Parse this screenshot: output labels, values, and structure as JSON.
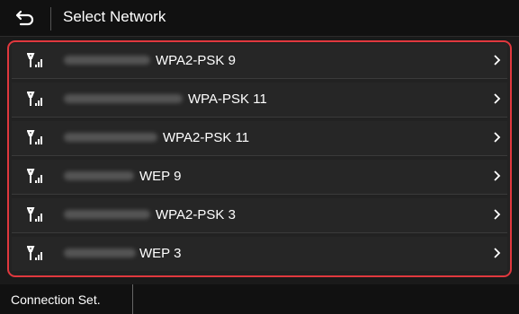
{
  "header": {
    "title": "Select Network",
    "back_icon": "back-arrow-icon"
  },
  "networks": [
    {
      "label": "WPA2-PSK 9",
      "icon": "antenna-signal-icon"
    },
    {
      "label": "WPA-PSK 11",
      "icon": "antenna-signal-icon"
    },
    {
      "label": "WPA2-PSK 11",
      "icon": "antenna-signal-icon"
    },
    {
      "label": "WEP 9",
      "icon": "antenna-signal-icon"
    },
    {
      "label": "WPA2-PSK 3",
      "icon": "antenna-signal-icon"
    },
    {
      "label": "WEP 3",
      "icon": "antenna-signal-icon"
    }
  ],
  "footer": {
    "connection_button": "Connection Set."
  },
  "colors": {
    "selection_border": "#e0383e",
    "background": "#1a1a1a",
    "text": "#ffffff"
  }
}
